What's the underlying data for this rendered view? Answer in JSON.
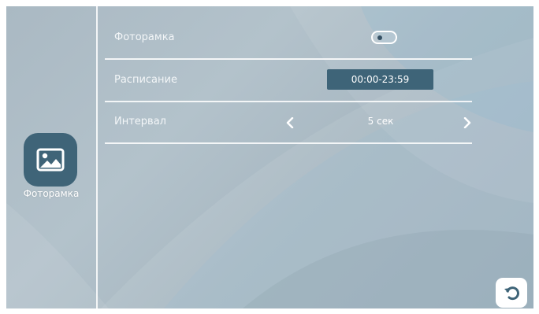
{
  "sidebar": {
    "app_icon": "image-icon",
    "app_label": "Фоторамка"
  },
  "settings": [
    {
      "label": "Фоторамка",
      "control": "toggle",
      "toggle_on": false
    },
    {
      "label": "Расписание",
      "control": "button",
      "value": "00:00-23:59"
    },
    {
      "label": "Интервал",
      "control": "stepper",
      "value": "5 сек"
    }
  ],
  "footer": {
    "back_icon": "undo-icon"
  },
  "colors": {
    "accent": "#3e6478",
    "background": "#aab9c3",
    "text": "#ffffff"
  }
}
